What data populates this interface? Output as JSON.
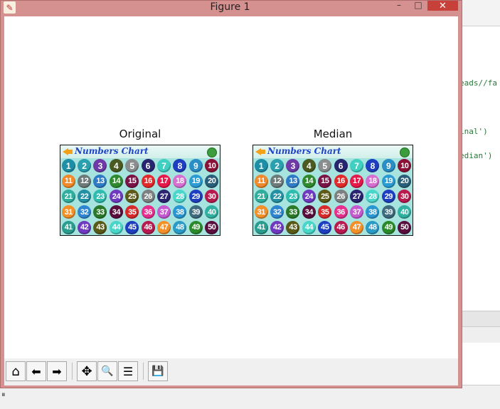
{
  "window": {
    "title": "Figure 1",
    "title_bar_color": "#d5918f",
    "close_glyph": "✕",
    "min_glyph": "–",
    "max_glyph": "□"
  },
  "background_editor": {
    "lines": [
      "eads//fa",
      "inal')",
      "edian')"
    ]
  },
  "panels": [
    {
      "title": "Original",
      "image_title": "Numbers Chart"
    },
    {
      "title": "Median",
      "image_title": "Numbers Chart"
    }
  ],
  "numbers": [
    "1",
    "2",
    "3",
    "4",
    "5",
    "6",
    "7",
    "8",
    "9",
    "10",
    "11",
    "12",
    "13",
    "14",
    "15",
    "16",
    "17",
    "18",
    "19",
    "20",
    "21",
    "22",
    "23",
    "24",
    "25",
    "26",
    "27",
    "28",
    "29",
    "30",
    "31",
    "32",
    "33",
    "34",
    "35",
    "36",
    "37",
    "38",
    "39",
    "40",
    "41",
    "42",
    "43",
    "44",
    "45",
    "46",
    "47",
    "48",
    "49",
    "50"
  ],
  "ball_colors": [
    "#1d8ea6",
    "#2a9fb0",
    "#6f3aa8",
    "#4b5a20",
    "#8a8d8e",
    "#272470",
    "#3fd0c1",
    "#1e3fc0",
    "#2a8ec6",
    "#8b1036",
    "#f08a2a",
    "#6d7a7a",
    "#2f7cc6",
    "#2f8a2f",
    "#7a1447",
    "#e32a2a",
    "#e6194a",
    "#d76fd3",
    "#2a9bd3",
    "#2a5f7a",
    "#2fae9d",
    "#2490a3",
    "#2fbdb0",
    "#6f3ac0",
    "#5e5a18",
    "#7d8081",
    "#2b2470",
    "#49d7cc",
    "#1e3fc0",
    "#b91a4e",
    "#f3902a",
    "#2f86d0",
    "#2a7a2a",
    "#5a0e3e",
    "#d72a2a",
    "#e6308e",
    "#c55ad0",
    "#2a97d3",
    "#3e6b7d",
    "#2fb0a0",
    "#2a9d8f",
    "#6f3ac0",
    "#5a5a18",
    "#47d6c8",
    "#1e3fc0",
    "#b81a50",
    "#f3902a",
    "#2a9bc6",
    "#2a8a2a",
    "#5a0e3e"
  ],
  "toolbar": [
    {
      "name": "home-icon",
      "glyph": "⌂"
    },
    {
      "name": "back-icon",
      "glyph": "⬅"
    },
    {
      "name": "forward-icon",
      "glyph": "➡"
    },
    {
      "name": "pan-icon",
      "glyph": "✥"
    },
    {
      "name": "zoom-icon",
      "glyph": "🔍"
    },
    {
      "name": "configure-subplots-icon",
      "glyph": "☰"
    },
    {
      "name": "save-icon",
      "glyph": "💾"
    }
  ]
}
